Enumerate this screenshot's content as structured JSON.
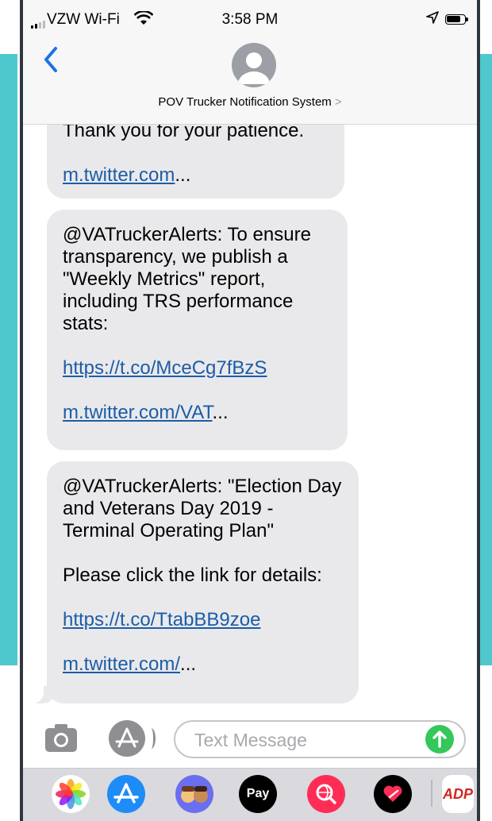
{
  "status_bar": {
    "carrier": "VZW Wi-Fi",
    "time": "3:58 PM",
    "icons": [
      "signal-icon",
      "wifi-icon",
      "location-icon",
      "battery-icon"
    ]
  },
  "nav": {
    "back_icon": "chevron-left-icon",
    "avatar_icon": "person-icon",
    "contact_name": "POV Trucker Notification System",
    "contact_chevron": ">"
  },
  "messages": [
    {
      "lines": [
        "Thank you for your patience."
      ],
      "link": "m.twitter.com",
      "link_suffix": "..."
    },
    {
      "text": "@VATruckerAlerts: To ensure transparency, we publish a \"Weekly Metrics\" report, including TRS performance stats:",
      "url": "https://t.co/MceCg7fBzS",
      "link": "m.twitter.com/VAT",
      "link_suffix": "..."
    },
    {
      "text": "@VATruckerAlerts: \"Election Day and Veterans Day 2019 - Terminal Operating Plan\"",
      "text2": "Please click the link for details:",
      "url": "https://t.co/TtabBB9zoe",
      "link": "m.twitter.com/",
      "link_suffix": "..."
    }
  ],
  "input_bar": {
    "camera_icon": "camera-icon",
    "apps_icon": "app-store-icon",
    "placeholder": "Text Message",
    "send_icon": "send-arrow-icon"
  },
  "app_drawer": {
    "apps": [
      "photos-icon",
      "app-store-icon",
      "memoji-icon",
      "apple-pay-icon",
      "web-search-icon",
      "digital-touch-icon",
      "adp-icon"
    ],
    "apple_pay_label": "Pay",
    "adp_label": "ADP"
  },
  "colors": {
    "accent": "#1a73e8",
    "bubble": "#e9e9eb",
    "link": "#1c5ca8",
    "send": "#34c759",
    "background_frame": "#4ec8cc"
  }
}
